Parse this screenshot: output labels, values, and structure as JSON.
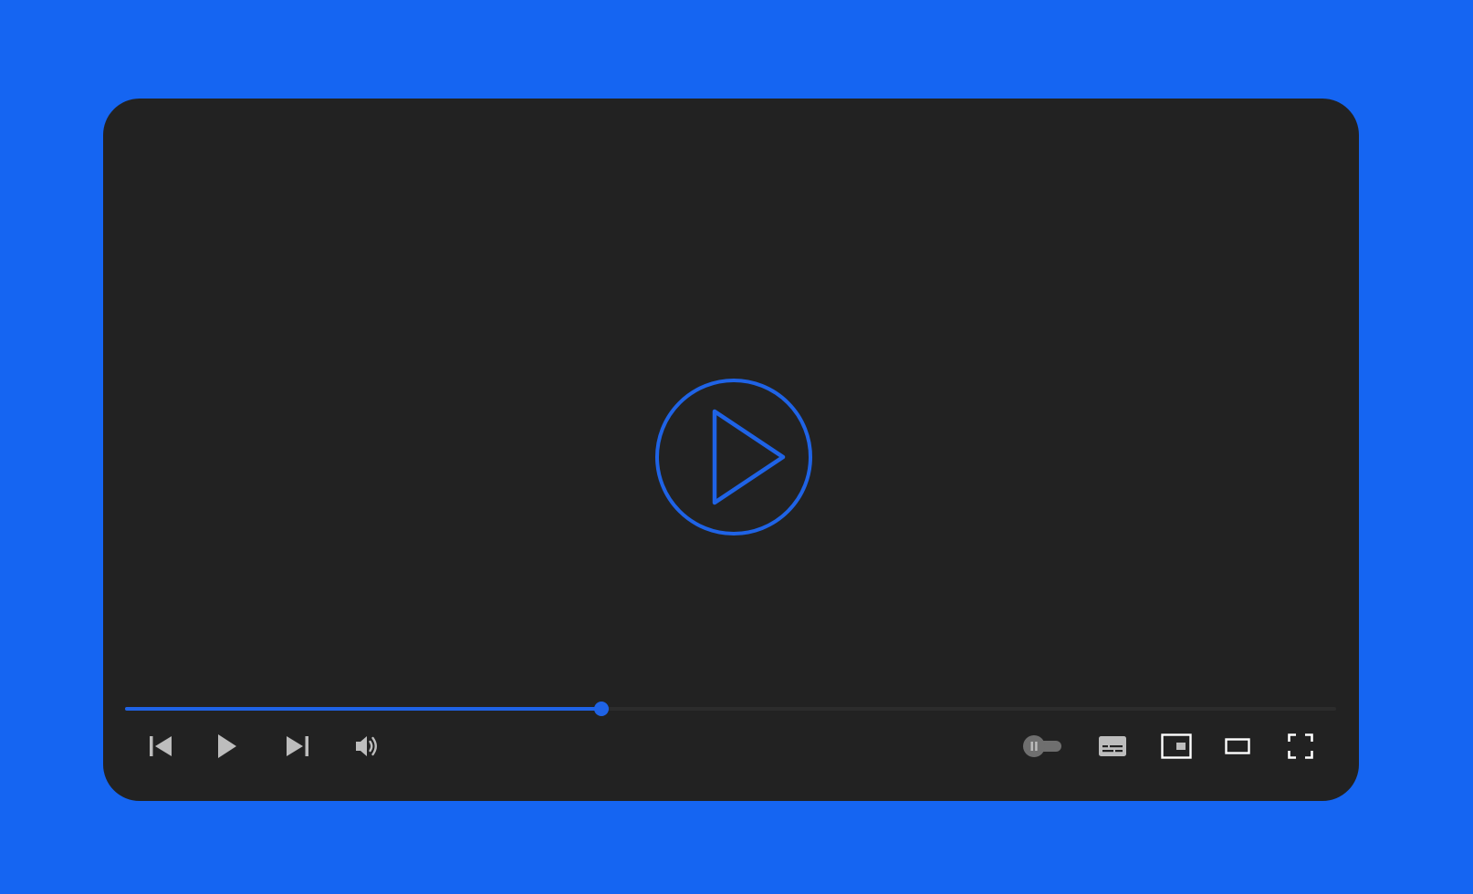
{
  "colors": {
    "background": "#1565f2",
    "player_bg": "#222222",
    "accent": "#1f63e6",
    "control": "#bdbdbd",
    "toggle_track": "#6f6f6f"
  },
  "player": {
    "progress": {
      "played_fraction": 0.393
    },
    "big_play_icon": "play-circle-icon",
    "controls_left": [
      {
        "name": "previous",
        "icon": "skip-previous-icon"
      },
      {
        "name": "play",
        "icon": "play-icon"
      },
      {
        "name": "next",
        "icon": "skip-next-icon"
      },
      {
        "name": "volume",
        "icon": "volume-icon"
      }
    ],
    "controls_right": [
      {
        "name": "autoplay",
        "icon": "autoplay-toggle-icon",
        "state": "paused"
      },
      {
        "name": "captions",
        "icon": "captions-icon"
      },
      {
        "name": "miniplayer",
        "icon": "miniplayer-icon"
      },
      {
        "name": "theater",
        "icon": "theater-mode-icon"
      },
      {
        "name": "fullscreen",
        "icon": "fullscreen-icon"
      }
    ]
  }
}
